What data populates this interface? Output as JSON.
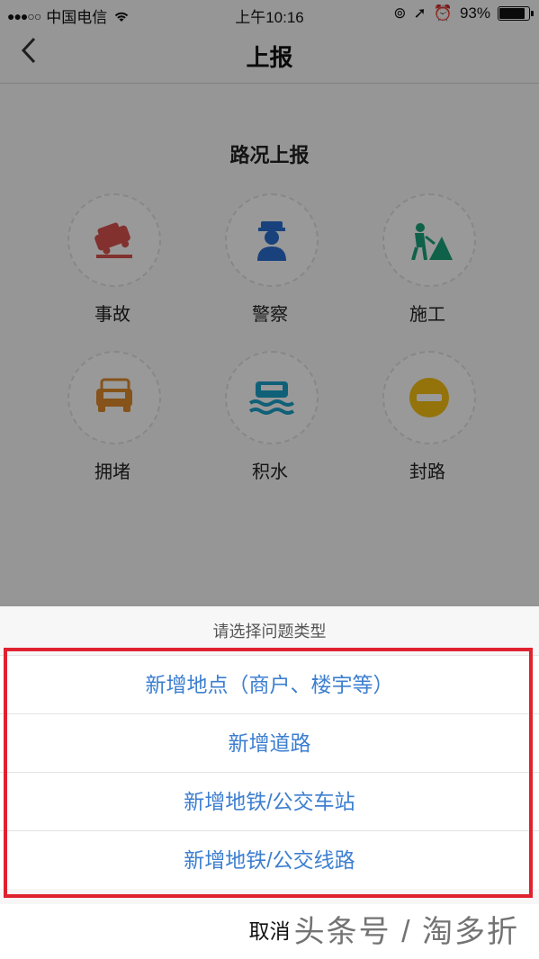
{
  "status_bar": {
    "carrier": "中国电信",
    "signal": "●●●○○",
    "time": "上午10:16",
    "battery": "93%"
  },
  "nav": {
    "title": "上报",
    "back_icon": "chevron-left-icon"
  },
  "section": {
    "title": "路况上报"
  },
  "report_types": [
    {
      "label": "事故",
      "icon": "car-crash-icon",
      "color": "#d9534f"
    },
    {
      "label": "警察",
      "icon": "police-icon",
      "color": "#2b6fd0"
    },
    {
      "label": "施工",
      "icon": "construction-icon",
      "color": "#1aa37a"
    },
    {
      "label": "拥堵",
      "icon": "traffic-jam-icon",
      "color": "#e08a2c"
    },
    {
      "label": "积水",
      "icon": "flood-icon",
      "color": "#1ba0c9"
    },
    {
      "label": "封路",
      "icon": "road-closed-icon",
      "color": "#f5c012"
    }
  ],
  "action_sheet": {
    "prompt": "请选择问题类型",
    "options": [
      {
        "label": "新增地点（商户、楼宇等）"
      },
      {
        "label": "新增道路"
      },
      {
        "label": "新增地铁/公交车站"
      },
      {
        "label": "新增地铁/公交线路"
      }
    ],
    "cancel": "取消"
  },
  "watermark": "头条号 / 淘多折",
  "colors": {
    "option_text": "#3d7fd0",
    "highlight_border": "#e0222f"
  }
}
